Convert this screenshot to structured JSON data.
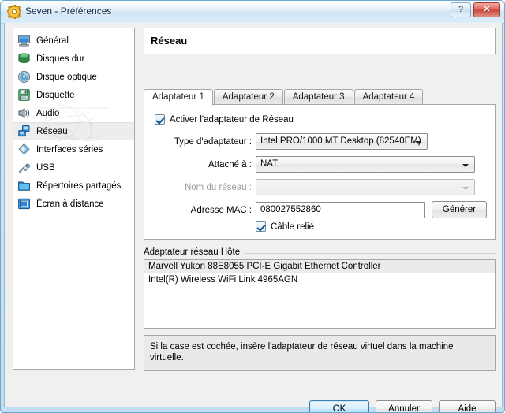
{
  "window": {
    "title": "Seven - Préférences",
    "app_icon": "gear-icon",
    "caption_buttons": {
      "help": "?",
      "close": "✕"
    }
  },
  "sidebar": {
    "items": [
      {
        "label": "Général",
        "icon": "monitor-icon",
        "selected": false
      },
      {
        "label": "Disques dur",
        "icon": "harddisk-icon",
        "selected": false
      },
      {
        "label": "Disque optique",
        "icon": "cd-icon",
        "selected": false
      },
      {
        "label": "Disquette",
        "icon": "floppy-icon",
        "selected": false
      },
      {
        "label": "Audio",
        "icon": "speaker-icon",
        "selected": false
      },
      {
        "label": "Réseau",
        "icon": "network-icon",
        "selected": true
      },
      {
        "label": "Interfaces séries",
        "icon": "serial-port-icon",
        "selected": false
      },
      {
        "label": "USB",
        "icon": "usb-icon",
        "selected": false
      },
      {
        "label": "Répertoires partagés",
        "icon": "folder-icon",
        "selected": false
      },
      {
        "label": "Écran à distance",
        "icon": "remote-screen-icon",
        "selected": false
      }
    ]
  },
  "header": {
    "title": "Réseau"
  },
  "tabs": [
    {
      "label": "Adaptateur 1",
      "active": true
    },
    {
      "label": "Adaptateur 2",
      "active": false
    },
    {
      "label": "Adaptateur 3",
      "active": false
    },
    {
      "label": "Adaptateur 4",
      "active": false
    }
  ],
  "form": {
    "enable_adapter": {
      "label": "Activer l'adaptateur de Réseau",
      "checked": true
    },
    "adapter_type": {
      "label": "Type d'adaptateur :",
      "value": "Intel PRO/1000 MT Desktop (82540EM)"
    },
    "attached_to": {
      "label": "Attaché à :",
      "value": "NAT"
    },
    "network_name": {
      "label": "Nom du réseau :",
      "value": "",
      "disabled": true
    },
    "mac_address": {
      "label": "Adresse MAC :",
      "value": "080027552860"
    },
    "generate_button": "Générer",
    "cable_connected": {
      "label": "Câble relié",
      "checked": true
    }
  },
  "host_adapter_group": {
    "legend": "Adaptateur réseau Hôte",
    "items": [
      "Marvell Yukon 88E8055 PCI-E Gigabit Ethernet Controller",
      "Intel(R) Wireless WiFi Link 4965AGN"
    ]
  },
  "info": {
    "text": "Si la case est cochée, insère l'adaptateur de réseau virtuel dans la machine virtuelle."
  },
  "footer": {
    "ok": "OK",
    "cancel": "Annuler",
    "help": "Aide"
  },
  "colors": {
    "accent": "#3c7fb1",
    "close_button": "#c8483e",
    "selection": "#ededed",
    "window_frame": "#cbe3f5"
  }
}
